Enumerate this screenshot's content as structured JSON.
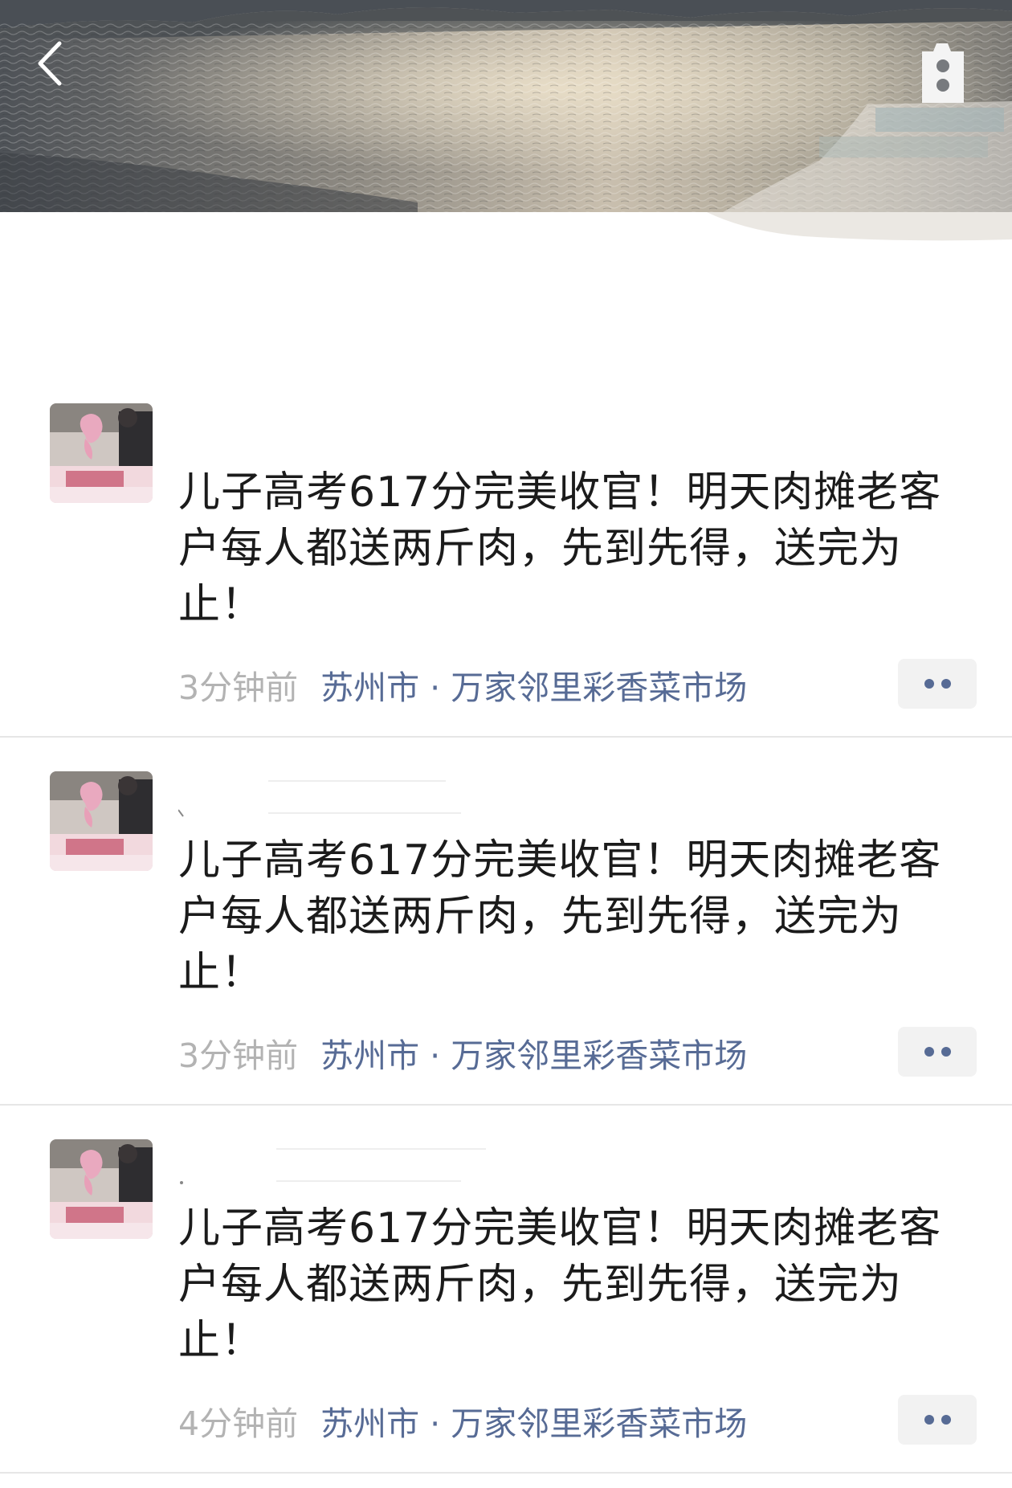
{
  "header": {
    "back_icon": "chevron-left-icon",
    "camera_icon": "camera-icon"
  },
  "colors": {
    "link": "#576b95",
    "time": "#b3b3b3",
    "text": "#1b1b1b",
    "more_button_bg": "#f2f2f2"
  },
  "posts": [
    {
      "text": "儿子高考617分完美收官！明天肉摊老客\n户每人都送两斤肉，先到先得，送完为\n止！",
      "time": "3分钟前",
      "location": "苏州市 · 万家邻里彩香菜市场",
      "more_icon": "more-dots-icon"
    },
    {
      "text": "儿子高考617分完美收官！明天肉摊老客\n户每人都送两斤肉，先到先得，送完为\n止！",
      "time": "3分钟前",
      "location": "苏州市 · 万家邻里彩香菜市场",
      "more_icon": "more-dots-icon"
    },
    {
      "text": "儿子高考617分完美收官！明天肉摊老客\n户每人都送两斤肉，先到先得，送完为\n止！",
      "time": "4分钟前",
      "location": "苏州市 · 万家邻里彩香菜市场",
      "more_icon": "more-dots-icon"
    }
  ]
}
